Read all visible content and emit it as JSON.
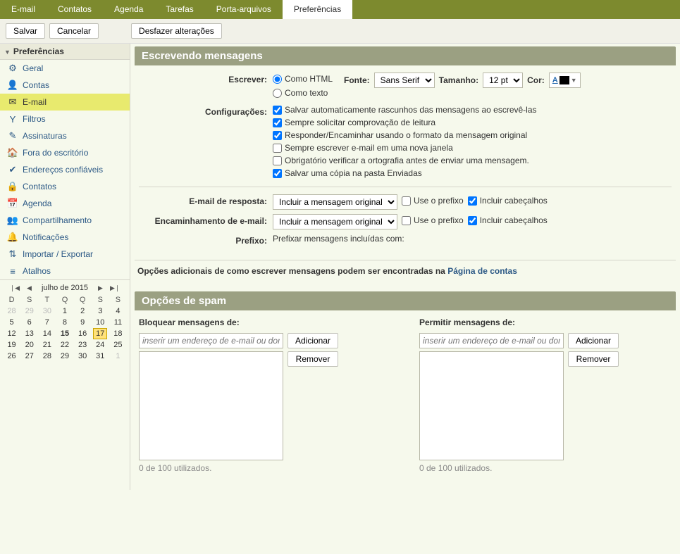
{
  "tabs": [
    "E-mail",
    "Contatos",
    "Agenda",
    "Tarefas",
    "Porta-arquivos",
    "Preferências"
  ],
  "active_tab": 5,
  "toolbar": {
    "save": "Salvar",
    "cancel": "Cancelar",
    "undo": "Desfazer alterações"
  },
  "sidebar": {
    "title": "Preferências",
    "items": [
      {
        "icon": "⚙",
        "label": "Geral"
      },
      {
        "icon": "👤",
        "label": "Contas"
      },
      {
        "icon": "✉",
        "label": "E-mail",
        "selected": true
      },
      {
        "icon": "Y",
        "label": "Filtros"
      },
      {
        "icon": "✎",
        "label": "Assinaturas"
      },
      {
        "icon": "🏠",
        "label": "Fora do escritório"
      },
      {
        "icon": "✔",
        "label": "Endereços confiáveis"
      },
      {
        "icon": "🔒",
        "label": "Contatos"
      },
      {
        "icon": "📅",
        "label": "Agenda"
      },
      {
        "icon": "👥",
        "label": "Compartilhamento"
      },
      {
        "icon": "🔔",
        "label": "Notificações"
      },
      {
        "icon": "⇅",
        "label": "Importar / Exportar"
      },
      {
        "icon": "≡",
        "label": "Atalhos"
      }
    ]
  },
  "calendar": {
    "title": "julho de 2015",
    "dow": [
      "D",
      "S",
      "T",
      "Q",
      "Q",
      "S",
      "S"
    ],
    "weeks": [
      [
        {
          "d": 28,
          "dim": true
        },
        {
          "d": 29,
          "dim": true
        },
        {
          "d": 30,
          "dim": true
        },
        {
          "d": 1
        },
        {
          "d": 2
        },
        {
          "d": 3
        },
        {
          "d": 4
        }
      ],
      [
        {
          "d": 5
        },
        {
          "d": 6
        },
        {
          "d": 7
        },
        {
          "d": 8
        },
        {
          "d": 9
        },
        {
          "d": 10
        },
        {
          "d": 11
        }
      ],
      [
        {
          "d": 12
        },
        {
          "d": 13
        },
        {
          "d": 14
        },
        {
          "d": 15,
          "bold": true
        },
        {
          "d": 16
        },
        {
          "d": 17,
          "today": true
        },
        {
          "d": 18
        }
      ],
      [
        {
          "d": 19
        },
        {
          "d": 20
        },
        {
          "d": 21
        },
        {
          "d": 22
        },
        {
          "d": 23
        },
        {
          "d": 24
        },
        {
          "d": 25
        }
      ],
      [
        {
          "d": 26
        },
        {
          "d": 27
        },
        {
          "d": 28
        },
        {
          "d": 29
        },
        {
          "d": 30
        },
        {
          "d": 31
        },
        {
          "d": 1,
          "dim": true
        }
      ]
    ]
  },
  "compose": {
    "heading": "Escrevendo mensagens",
    "write_label": "Escrever:",
    "as_html": "Como HTML",
    "as_text": "Como texto",
    "font_label": "Fonte:",
    "font_value": "Sans Serif",
    "size_label": "Tamanho:",
    "size_value": "12 pt",
    "color_label": "Cor:",
    "settings_label": "Configurações:",
    "chk_autosave": "Salvar automaticamente rascunhos das mensagens ao escrevê-las",
    "chk_receipt": "Sempre solicitar comprovação de leitura",
    "chk_orig_format": "Responder/Encaminhar usando o formato da mensagem original",
    "chk_new_window": "Sempre escrever e-mail em uma nova janela",
    "chk_spell": "Obrigatório verificar a ortografia antes de enviar uma mensagem.",
    "chk_save_sent": "Salvar uma cópia na pasta Enviadas",
    "reply_label": "E-mail de resposta:",
    "reply_select": "Incluir a mensagem original",
    "fwd_label": "Encaminhamento de e-mail:",
    "fwd_select": "Incluir a mensagem original",
    "use_prefix": "Use o prefixo",
    "include_headers": "Incluir cabeçalhos",
    "prefix_label": "Prefixo:",
    "prefix_text": "Prefixar mensagens incluídas com:",
    "note_pre": "Opções adicionais de como escrever mensagens podem ser encontradas na ",
    "note_link": "Página de contas"
  },
  "spam": {
    "heading": "Opções de spam",
    "block_label": "Bloquear mensagens de:",
    "allow_label": "Permitir mensagens de:",
    "placeholder": "inserir um endereço de e-mail ou dom",
    "add": "Adicionar",
    "remove": "Remover",
    "usage": "0 de 100 utilizados."
  }
}
